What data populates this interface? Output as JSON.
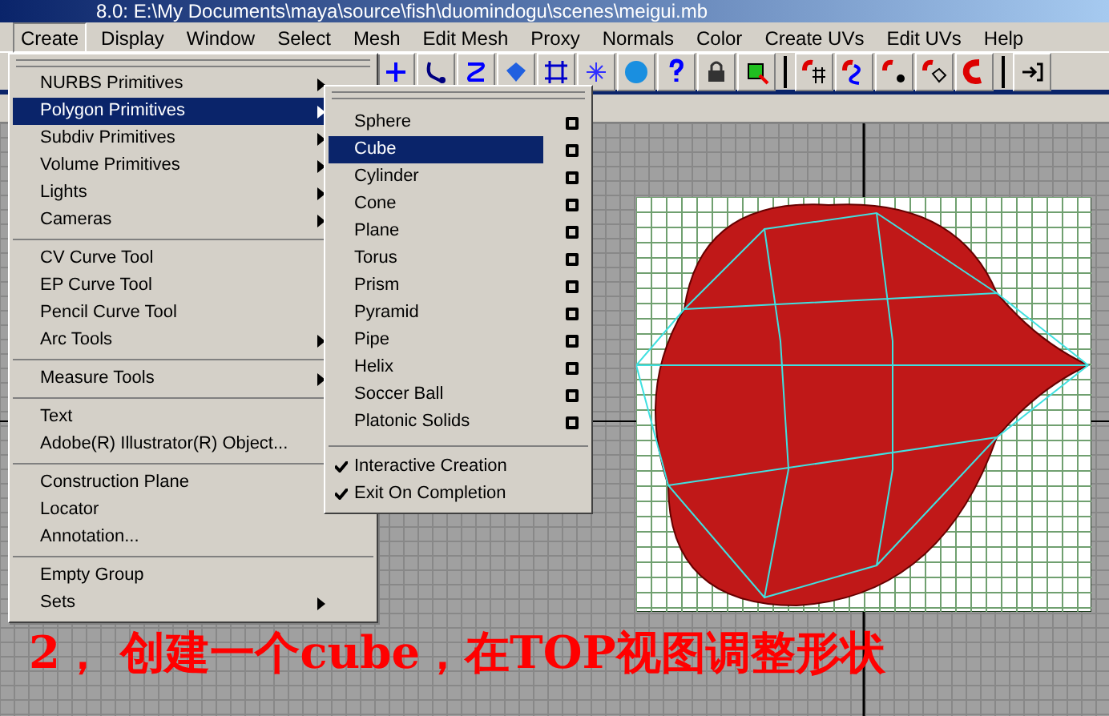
{
  "window": {
    "title": "8.0: E:\\My Documents\\maya\\source\\fish\\duomindogu\\scenes\\meigui.mb"
  },
  "menubar": [
    {
      "label": "Create",
      "selected": true
    },
    {
      "label": "Display",
      "selected": false
    },
    {
      "label": "Window",
      "selected": false
    },
    {
      "label": "Select",
      "selected": false
    },
    {
      "label": "Mesh",
      "selected": false
    },
    {
      "label": "Edit Mesh",
      "selected": false
    },
    {
      "label": "Proxy",
      "selected": false
    },
    {
      "label": "Normals",
      "selected": false
    },
    {
      "label": "Color",
      "selected": false
    },
    {
      "label": "Create UVs",
      "selected": false
    },
    {
      "label": "Edit UVs",
      "selected": false
    },
    {
      "label": "Help",
      "selected": false
    }
  ],
  "create_menu": {
    "sections": [
      [
        {
          "label": "NURBS Primitives",
          "submenu": true,
          "selected": false
        },
        {
          "label": "Polygon Primitives",
          "submenu": true,
          "selected": true
        },
        {
          "label": "Subdiv Primitives",
          "submenu": true,
          "selected": false
        },
        {
          "label": "Volume Primitives",
          "submenu": true,
          "selected": false
        },
        {
          "label": "Lights",
          "submenu": true,
          "selected": false
        },
        {
          "label": "Cameras",
          "submenu": true,
          "selected": false
        }
      ],
      [
        {
          "label": "CV Curve Tool",
          "submenu": false,
          "selected": false
        },
        {
          "label": "EP Curve Tool",
          "submenu": false,
          "selected": false
        },
        {
          "label": "Pencil Curve Tool",
          "submenu": false,
          "selected": false
        },
        {
          "label": "Arc Tools",
          "submenu": true,
          "selected": false
        }
      ],
      [
        {
          "label": "Measure Tools",
          "submenu": true,
          "selected": false
        }
      ],
      [
        {
          "label": "Text",
          "submenu": false,
          "selected": false
        },
        {
          "label": "Adobe(R) Illustrator(R) Object...",
          "submenu": false,
          "selected": false
        }
      ],
      [
        {
          "label": "Construction Plane",
          "submenu": false,
          "selected": false
        },
        {
          "label": "Locator",
          "submenu": false,
          "selected": false
        },
        {
          "label": "Annotation...",
          "submenu": false,
          "selected": false
        }
      ],
      [
        {
          "label": "Empty Group",
          "submenu": false,
          "selected": false
        },
        {
          "label": "Sets",
          "submenu": true,
          "selected": false
        }
      ]
    ]
  },
  "polygon_primitives_menu": {
    "items": [
      {
        "label": "Sphere",
        "selected": false,
        "option_box": true
      },
      {
        "label": "Cube",
        "selected": true,
        "option_box": true
      },
      {
        "label": "Cylinder",
        "selected": false,
        "option_box": true
      },
      {
        "label": "Cone",
        "selected": false,
        "option_box": true
      },
      {
        "label": "Plane",
        "selected": false,
        "option_box": true
      },
      {
        "label": "Torus",
        "selected": false,
        "option_box": true
      },
      {
        "label": "Prism",
        "selected": false,
        "option_box": true
      },
      {
        "label": "Pyramid",
        "selected": false,
        "option_box": true
      },
      {
        "label": "Pipe",
        "selected": false,
        "option_box": true
      },
      {
        "label": "Helix",
        "selected": false,
        "option_box": true
      },
      {
        "label": "Soccer Ball",
        "selected": false,
        "option_box": true
      },
      {
        "label": "Platonic Solids",
        "selected": false,
        "option_box": true
      }
    ],
    "options": [
      {
        "label": "Interactive Creation",
        "checked": true
      },
      {
        "label": "Exit On Completion",
        "checked": true
      }
    ]
  },
  "caption": "2， 创建一个cube，在TOP视图调整形状"
}
